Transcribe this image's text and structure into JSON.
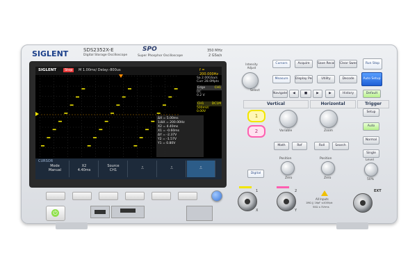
{
  "brand": "SIGLENT",
  "model": "SDS2352X-E",
  "subtitle": "Digital Storage Oscilloscope",
  "spo": "SPO",
  "spo_sub": "Super Phosphor Oscilloscope",
  "spec_bw": "350 MHz",
  "spec_sr": "2 GSa/s",
  "screen": {
    "brand": "SIGLENT",
    "mode_badge": "Stop",
    "timebase": "M 1.00ms/ Delay:-800us",
    "trig_time": "f = 200.000Hz",
    "sa_rate": "Sa 2.00GSa/s",
    "curr_pts": "Curr 28.0Mpts",
    "trig_mode": "Edge",
    "trig_ch": "CH1",
    "trig_coupling": "DC",
    "trig_level": "0.2 V",
    "ch1_label": "CH1",
    "ch1_coupling": "DC1M",
    "ch1_scale": "500mV/",
    "ch1_offset": "0.00V",
    "measurements": [
      "ΔX = 5.00ms",
      "1/ΔX = 200.00Hz",
      "X2 = 4.40ms",
      "X1 = -0.60ms",
      "ΔY = -2.37V",
      "Y2 = -1.57V",
      "Y1 = 0.80V"
    ],
    "menu_title": "CURSOR",
    "menu": [
      {
        "top": "Mode",
        "bottom": "Manual"
      },
      {
        "top": "X2",
        "bottom": "4.40ms"
      },
      {
        "top": "Source",
        "bottom": "CH1"
      },
      {
        "top": "",
        "bottom": ""
      },
      {
        "top": "",
        "bottom": ""
      },
      {
        "top": "",
        "bottom": ""
      }
    ],
    "waveform": {
      "type": "staircase",
      "periods": 3,
      "steps_per_period": 8
    }
  },
  "front_panel": {
    "intensity_label": "Intensity Adjust",
    "select_label": "Select",
    "navigate": "Navigate",
    "history": "History",
    "buttons_row1": [
      "Cursors",
      "Acquire",
      "Save Recall",
      "Clear Sweeps",
      "Run Stop"
    ],
    "buttons_row2": [
      "Measure",
      "Display Persist",
      "Utility",
      "Decode",
      "Auto Setup"
    ],
    "default": "Default",
    "vertical": "Vertical",
    "horizontal": "Horizontal",
    "trigger": "Trigger",
    "ch1_btn": "1",
    "ch2_btn": "2",
    "variable": "Variable",
    "zoom": "Zoom",
    "math": "Math",
    "ref": "Ref",
    "roll": "Roll",
    "search": "Search",
    "setup": "Setup",
    "auto": "Auto",
    "normal": "Normal",
    "single": "Single",
    "position1": "Position",
    "position2": "Position",
    "zero1": "Zero",
    "zero2": "Zero",
    "level": "Level",
    "level_50": "50%",
    "digital": "Digital",
    "ch1_in": "1",
    "ch2_in": "2",
    "ext": "EXT",
    "x": "X",
    "y": "Y",
    "all_inputs": "All Inputs",
    "input_spec": "1MΩ || 16pF ≤400Vpk",
    "input_spec2": "50Ω ≤ 5Vrms"
  },
  "colors": {
    "ch1": "#f2e600",
    "ch2": "#ff5fb0",
    "accent": "#1e5fd6"
  }
}
